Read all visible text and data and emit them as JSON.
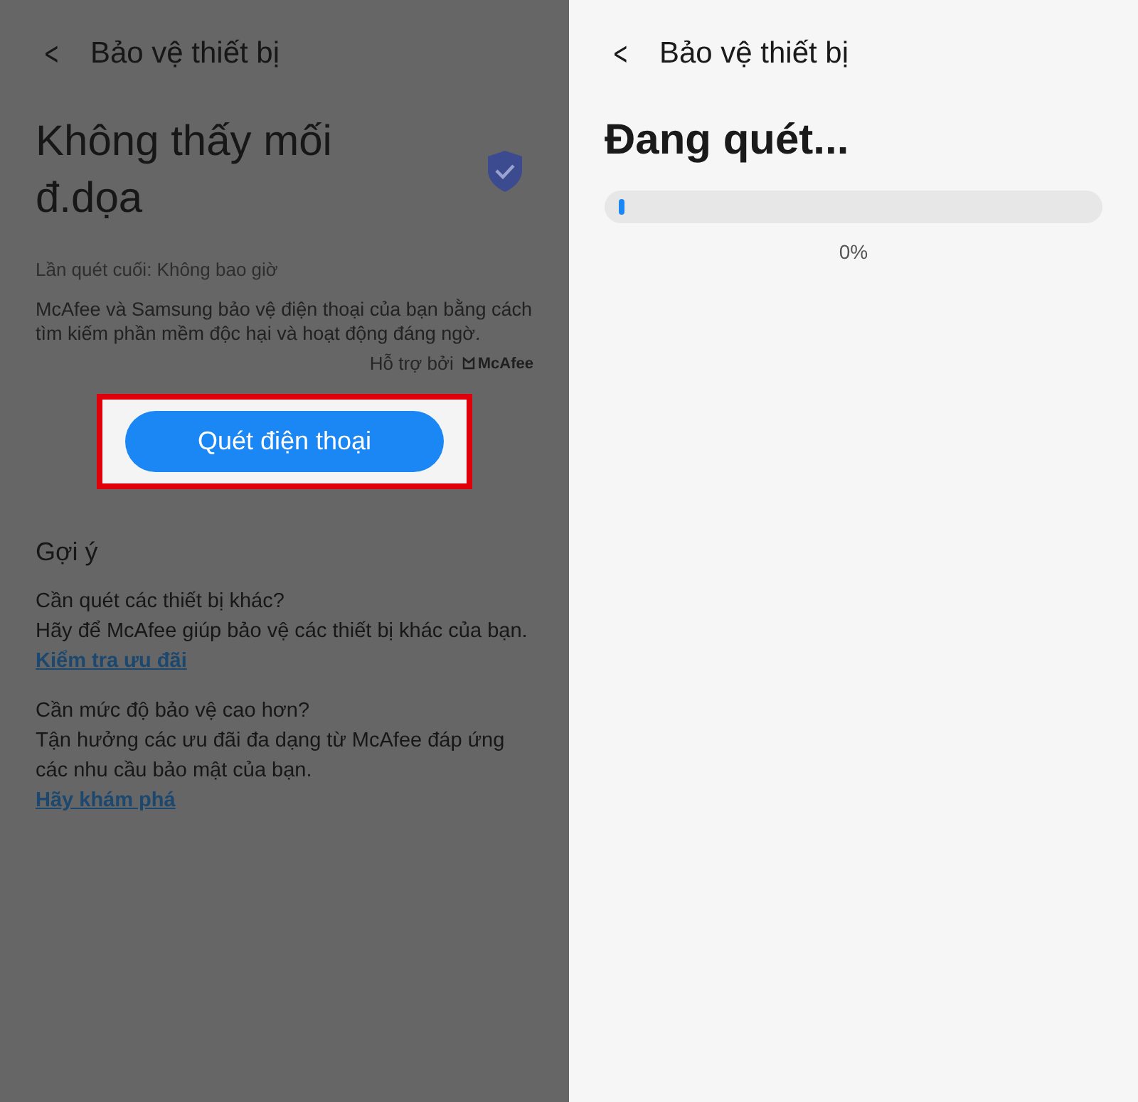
{
  "screens": [
    {
      "dimmed": true,
      "header": {
        "back": "<",
        "title": "Bảo vệ thiết bị"
      },
      "status_title": "Không thấy mối đ.dọa",
      "last_scan": "Lần quét cuối: Không bao giờ",
      "description": "McAfee và Samsung bảo vệ điện thoại của bạn bằng cách tìm kiếm phần mềm độc hại và hoạt động đáng ngờ.",
      "powered_by": {
        "label": "Hỗ trợ bởi",
        "brand": "McAfee"
      },
      "scan_button": {
        "label": "Quét điện thoại",
        "highlighted": true
      },
      "suggestions": {
        "title": "Gợi ý",
        "items": [
          {
            "question": "Cần quét các thiết bị khác?",
            "text": "Hãy để McAfee giúp bảo vệ các thiết bị khác của bạn.",
            "link": "Kiểm tra ưu đãi"
          },
          {
            "question": "Cần mức độ bảo vệ cao hơn?",
            "text": "Tận hưởng các ưu đãi đa dạng từ McAfee đáp ứng các nhu cầu bảo mật của bạn.",
            "link": "Hãy khám phá"
          }
        ]
      }
    },
    {
      "dimmed": false,
      "header": {
        "back": "<",
        "title": "Bảo vệ thiết bị"
      },
      "status_title": "Đang quét...",
      "progress": {
        "level": 0.01,
        "reading": "0%"
      }
    }
  ]
}
